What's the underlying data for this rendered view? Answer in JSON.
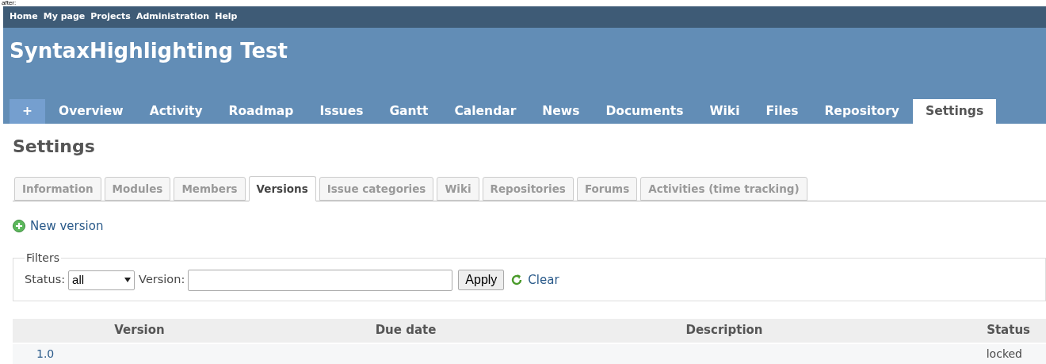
{
  "caption": "after:",
  "top_menu": [
    "Home",
    "My page",
    "Projects",
    "Administration",
    "Help"
  ],
  "project_title": "SyntaxHighlighting Test",
  "main_menu": [
    {
      "label": "+",
      "kind": "new",
      "selected": false
    },
    {
      "label": "Overview",
      "kind": "tab",
      "selected": false
    },
    {
      "label": "Activity",
      "kind": "tab",
      "selected": false
    },
    {
      "label": "Roadmap",
      "kind": "tab",
      "selected": false
    },
    {
      "label": "Issues",
      "kind": "tab",
      "selected": false
    },
    {
      "label": "Gantt",
      "kind": "tab",
      "selected": false
    },
    {
      "label": "Calendar",
      "kind": "tab",
      "selected": false
    },
    {
      "label": "News",
      "kind": "tab",
      "selected": false
    },
    {
      "label": "Documents",
      "kind": "tab",
      "selected": false
    },
    {
      "label": "Wiki",
      "kind": "tab",
      "selected": false
    },
    {
      "label": "Files",
      "kind": "tab",
      "selected": false
    },
    {
      "label": "Repository",
      "kind": "tab",
      "selected": false
    },
    {
      "label": "Settings",
      "kind": "tab",
      "selected": true
    }
  ],
  "heading": "Settings",
  "tabs": [
    {
      "label": "Information",
      "selected": false
    },
    {
      "label": "Modules",
      "selected": false
    },
    {
      "label": "Members",
      "selected": false
    },
    {
      "label": "Versions",
      "selected": true
    },
    {
      "label": "Issue categories",
      "selected": false
    },
    {
      "label": "Wiki",
      "selected": false
    },
    {
      "label": "Repositories",
      "selected": false
    },
    {
      "label": "Forums",
      "selected": false
    },
    {
      "label": "Activities (time tracking)",
      "selected": false
    }
  ],
  "new_version_link": "New version",
  "filters": {
    "legend": "Filters",
    "status_label": "Status:",
    "status_value": "all",
    "version_label": "Version:",
    "apply_button": "Apply",
    "clear_link": "Clear"
  },
  "table": {
    "columns": [
      "Version",
      "Due date",
      "Description",
      "Status"
    ],
    "rows": [
      {
        "version": "1.0",
        "due_date": "",
        "description": "",
        "status": "locked"
      }
    ]
  }
}
